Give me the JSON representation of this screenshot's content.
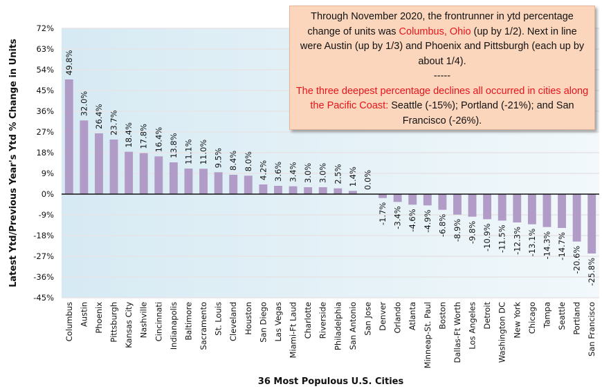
{
  "chart_data": {
    "type": "bar",
    "title": "",
    "xlabel": "36 Most Populous U.S. Cities",
    "ylabel": "Latest Ytd/Previous Year's Ytd % Change in Units",
    "ylim": [
      -45,
      72
    ],
    "yticks": [
      72,
      63,
      54,
      45,
      36,
      27,
      18,
      9,
      0,
      -9,
      -18,
      -27,
      -36,
      -45
    ],
    "ytick_labels": [
      "72%",
      "63%",
      "54%",
      "45%",
      "36%",
      "27%",
      "18%",
      "9%",
      "0%",
      "-9%",
      "-18%",
      "-27%",
      "-36%",
      "-45%"
    ],
    "grid": true,
    "legend": "none",
    "bar_color": "#b09cc6",
    "plot_bg": "#dceef5",
    "categories": [
      "Columbus",
      "Austin",
      "Phoenix",
      "Pittsburgh",
      "Kansas City",
      "Nashville",
      "Cincinnati",
      "Indianapolis",
      "Baltimore",
      "Sacramento",
      "St. Louis",
      "Cleveland",
      "Houston",
      "San Diego",
      "Las Vegas",
      "Miami-Ft Laud",
      "Charlotte",
      "Riverside",
      "Philadelphia",
      "San Antonio",
      "San Jose",
      "Denver",
      "Orlando",
      "Atlanta",
      "Minneap-St. Paul",
      "Boston",
      "Dallas-Ft Worth",
      "Los Angeles",
      "Detroit",
      "Washington DC",
      "New York",
      "Chicago",
      "Tampa",
      "Seattle",
      "Portland",
      "San Francisco"
    ],
    "values": [
      49.8,
      32.0,
      26.4,
      23.7,
      18.4,
      17.8,
      16.4,
      13.8,
      11.1,
      11.0,
      9.5,
      8.4,
      8.0,
      4.2,
      3.6,
      3.4,
      3.0,
      3.0,
      2.5,
      1.4,
      0.0,
      -1.7,
      -3.4,
      -4.6,
      -4.9,
      -6.8,
      -8.9,
      -9.8,
      -10.9,
      -11.5,
      -12.3,
      -13.1,
      -14.3,
      -14.7,
      -20.6,
      -25.8
    ],
    "data_labels": [
      "49.8%",
      "32.0%",
      "26.4%",
      "23.7%",
      "18.4%",
      "17.8%",
      "16.4%",
      "13.8%",
      "11.1%",
      "11.0%",
      "9.5%",
      "8.4%",
      "8.0%",
      "4.2%",
      "3.6%",
      "3.4%",
      "3.0%",
      "3.0%",
      "2.5%",
      "1.4%",
      "0.0%",
      "-1.7%",
      "-3.4%",
      "-4.6%",
      "-4.9%",
      "-6.8%",
      "-8.9%",
      "-9.8%",
      "-10.9%",
      "-11.5%",
      "-12.3%",
      "-13.1%",
      "-14.3%",
      "-14.7%",
      "-20.6%",
      "-25.8%"
    ],
    "annotation": {
      "para1_pre": "Through November 2020, the frontrunner in ytd percentage change of units was ",
      "para1_highlight": "Columbus, Ohio",
      "para1_post": " (up by 1/2). Next in line were Austin (up by 1/3) and Phoenix and Pittsburgh (each up by about 1/4).",
      "separator": "-----",
      "para2_highlight": "The three deepest percentage declines all occurred in cities along the Pacific Coast:",
      "para2_post": " Seattle (-15%); Portland (-21%); and San Francisco (-26%).",
      "highlight_color": "#e8141c",
      "box_color": "#fbd6bd"
    }
  }
}
